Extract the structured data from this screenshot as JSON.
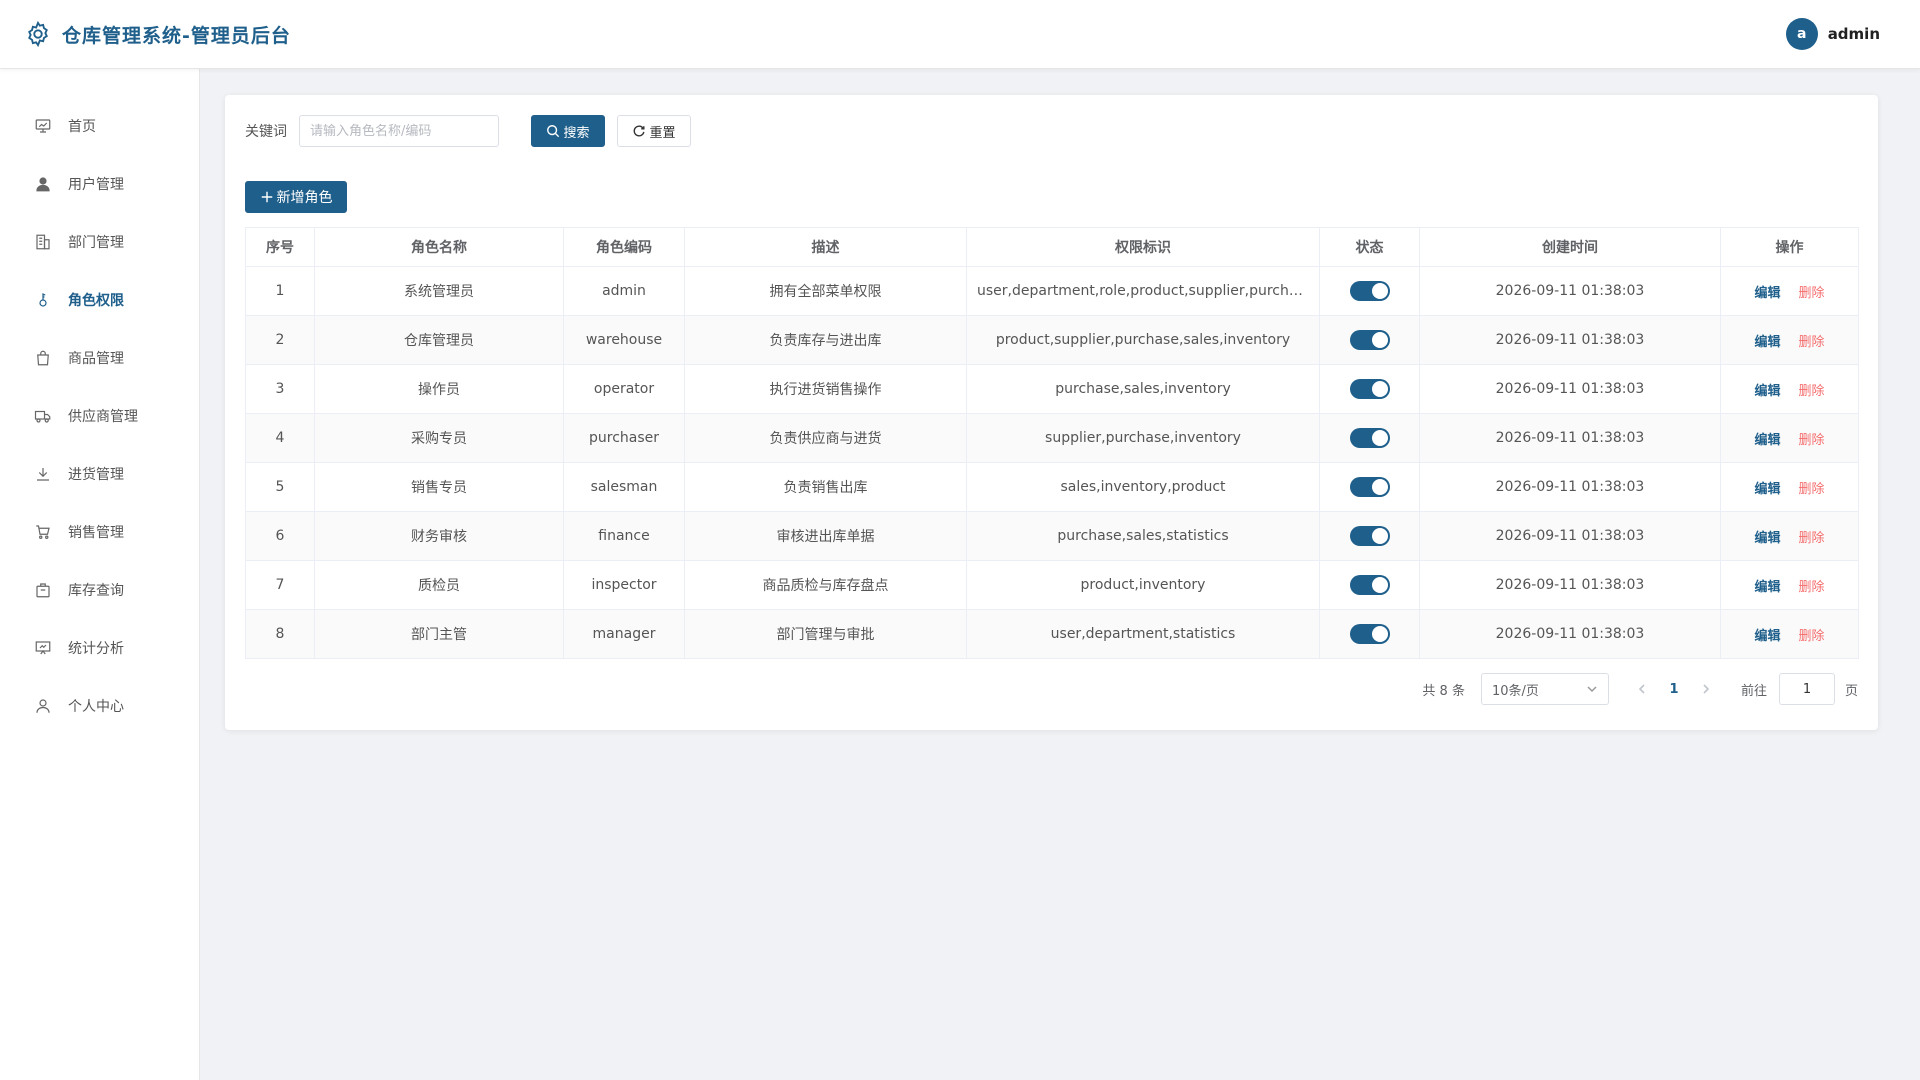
{
  "header": {
    "title": "仓库管理系统-管理员后台",
    "avatar_letter": "a",
    "username": "admin"
  },
  "sidebar": {
    "items": [
      {
        "label": "首页",
        "icon": "chart-board-icon"
      },
      {
        "label": "用户管理",
        "icon": "user-filled-icon"
      },
      {
        "label": "部门管理",
        "icon": "building-icon"
      },
      {
        "label": "角色权限",
        "icon": "key-icon",
        "active": true
      },
      {
        "label": "商品管理",
        "icon": "shopping-bag-icon"
      },
      {
        "label": "供应商管理",
        "icon": "truck-icon"
      },
      {
        "label": "进货管理",
        "icon": "download-icon"
      },
      {
        "label": "销售管理",
        "icon": "cart-icon"
      },
      {
        "label": "库存查询",
        "icon": "box-icon"
      },
      {
        "label": "统计分析",
        "icon": "presentation-chart-icon"
      },
      {
        "label": "个人中心",
        "icon": "user-outline-icon"
      }
    ]
  },
  "search": {
    "label": "关键词",
    "placeholder": "请输入角色名称/编码",
    "value": "",
    "search_button": "搜索",
    "reset_button": "重置"
  },
  "add_button": "新增角色",
  "table": {
    "headers": [
      "序号",
      "角色名称",
      "角色编码",
      "描述",
      "权限标识",
      "状态",
      "创建时间",
      "操作"
    ],
    "edit_label": "编辑",
    "delete_label": "删除",
    "rows": [
      {
        "no": "1",
        "name": "系统管理员",
        "code": "admin",
        "desc": "拥有全部菜单权限",
        "perms": "user,department,role,product,supplier,purchase,sales,inventory,statistics",
        "enabled": true,
        "created": "2026-09-11 01:38:03"
      },
      {
        "no": "2",
        "name": "仓库管理员",
        "code": "warehouse",
        "desc": "负责库存与进出库",
        "perms": "product,supplier,purchase,sales,inventory",
        "enabled": true,
        "created": "2026-09-11 01:38:03"
      },
      {
        "no": "3",
        "name": "操作员",
        "code": "operator",
        "desc": "执行进货销售操作",
        "perms": "purchase,sales,inventory",
        "enabled": true,
        "created": "2026-09-11 01:38:03"
      },
      {
        "no": "4",
        "name": "采购专员",
        "code": "purchaser",
        "desc": "负责供应商与进货",
        "perms": "supplier,purchase,inventory",
        "enabled": true,
        "created": "2026-09-11 01:38:03"
      },
      {
        "no": "5",
        "name": "销售专员",
        "code": "salesman",
        "desc": "负责销售出库",
        "perms": "sales,inventory,product",
        "enabled": true,
        "created": "2026-09-11 01:38:03"
      },
      {
        "no": "6",
        "name": "财务审核",
        "code": "finance",
        "desc": "审核进出库单据",
        "perms": "purchase,sales,statistics",
        "enabled": true,
        "created": "2026-09-11 01:38:03"
      },
      {
        "no": "7",
        "name": "质检员",
        "code": "inspector",
        "desc": "商品质检与库存盘点",
        "perms": "product,inventory",
        "enabled": true,
        "created": "2026-09-11 01:38:03"
      },
      {
        "no": "8",
        "name": "部门主管",
        "code": "manager",
        "desc": "部门管理与审批",
        "perms": "user,department,statistics",
        "enabled": true,
        "created": "2026-09-11 01:38:03"
      }
    ]
  },
  "pagination": {
    "total_text": "共 8 条",
    "page_size": "10条/页",
    "current_page": "1",
    "goto_label": "前往",
    "goto_value": "1",
    "page_suffix": "页"
  },
  "colors": {
    "primary": "#1f5f8b",
    "danger": "#f56c6c"
  }
}
